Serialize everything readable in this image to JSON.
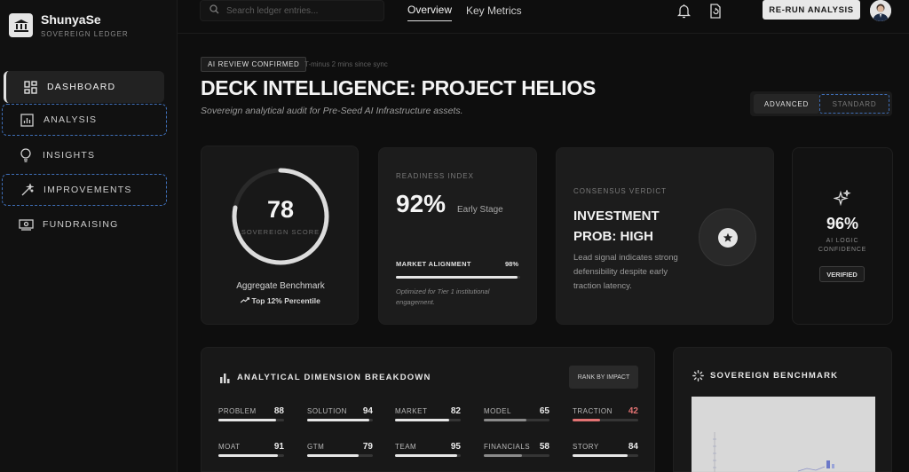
{
  "brand": {
    "name": "ShunyaSe",
    "subtitle": "SOVEREIGN LEDGER"
  },
  "sidebar": {
    "items": [
      {
        "label": "DASHBOARD",
        "icon": "dashboard-grid-icon",
        "active": true
      },
      {
        "label": "ANALYSIS",
        "icon": "bar-chart-icon"
      },
      {
        "label": "INSIGHTS",
        "icon": "lightbulb-icon"
      },
      {
        "label": "IMPROVEMENTS",
        "icon": "magic-wand-icon"
      },
      {
        "label": "FUNDRAISING",
        "icon": "cash-icon"
      }
    ]
  },
  "topbar": {
    "search_placeholder": "Search ledger entries...",
    "tabs": [
      {
        "label": "Overview"
      },
      {
        "label": "Key Metrics"
      }
    ],
    "rerun_label": "RE-RUN ANALYSIS"
  },
  "header": {
    "badge": "AI REVIEW CONFIRMED",
    "sync": "T-minus 2 mins since sync",
    "title": "DECK INTELLIGENCE: PROJECT HELIOS",
    "subtitle": "Sovereign analytical audit for Pre-Seed AI Infrastructure assets.",
    "mode_advanced": "ADVANCED",
    "mode_standard": "STANDARD"
  },
  "score_card": {
    "score": "78",
    "score_fraction": 0.78,
    "label": "SOVEREIGN SCORE",
    "benchmark": "Aggregate Benchmark",
    "percentile": "Top 12% Percentile"
  },
  "readiness": {
    "label": "READINESS INDEX",
    "value": "92%",
    "stage": "Early Stage",
    "alignment_label": "MARKET ALIGNMENT",
    "alignment_value": "98%",
    "alignment_fraction": 0.98,
    "note": "Optimized for Tier 1 institutional engagement."
  },
  "verdict": {
    "label": "CONSENSUS VERDICT",
    "line1": "INVESTMENT",
    "line2": "PROB: HIGH",
    "desc": "Lead signal indicates strong defensibility despite early traction latency."
  },
  "confidence": {
    "value": "96%",
    "label_line1": "AI LOGIC",
    "label_line2": "CONFIDENCE",
    "badge": "VERIFIED"
  },
  "breakdown": {
    "title": "ANALYTICAL DIMENSION BREAKDOWN",
    "rank_button": "RANK BY IMPACT",
    "dimensions": [
      {
        "name": "PROBLEM",
        "value": "88",
        "fraction": 0.88
      },
      {
        "name": "SOLUTION",
        "value": "94",
        "fraction": 0.94
      },
      {
        "name": "MARKET",
        "value": "82",
        "fraction": 0.82
      },
      {
        "name": "MODEL",
        "value": "65",
        "fraction": 0.65,
        "muted": true
      },
      {
        "name": "TRACTION",
        "value": "42",
        "fraction": 0.42,
        "alert": true
      },
      {
        "name": "MOAT",
        "value": "91",
        "fraction": 0.91
      },
      {
        "name": "GTM",
        "value": "79",
        "fraction": 0.79
      },
      {
        "name": "TEAM",
        "value": "95",
        "fraction": 0.95
      },
      {
        "name": "FINANCIALS",
        "value": "58",
        "fraction": 0.58,
        "muted": true
      },
      {
        "name": "STORY",
        "value": "84",
        "fraction": 0.84
      }
    ]
  },
  "benchmark_panel": {
    "title": "SOVEREIGN BENCHMARK"
  },
  "colors": {
    "alert": "#e27373",
    "accent": "#e6e6e6",
    "dashed_focus": "#3f6fb8"
  }
}
